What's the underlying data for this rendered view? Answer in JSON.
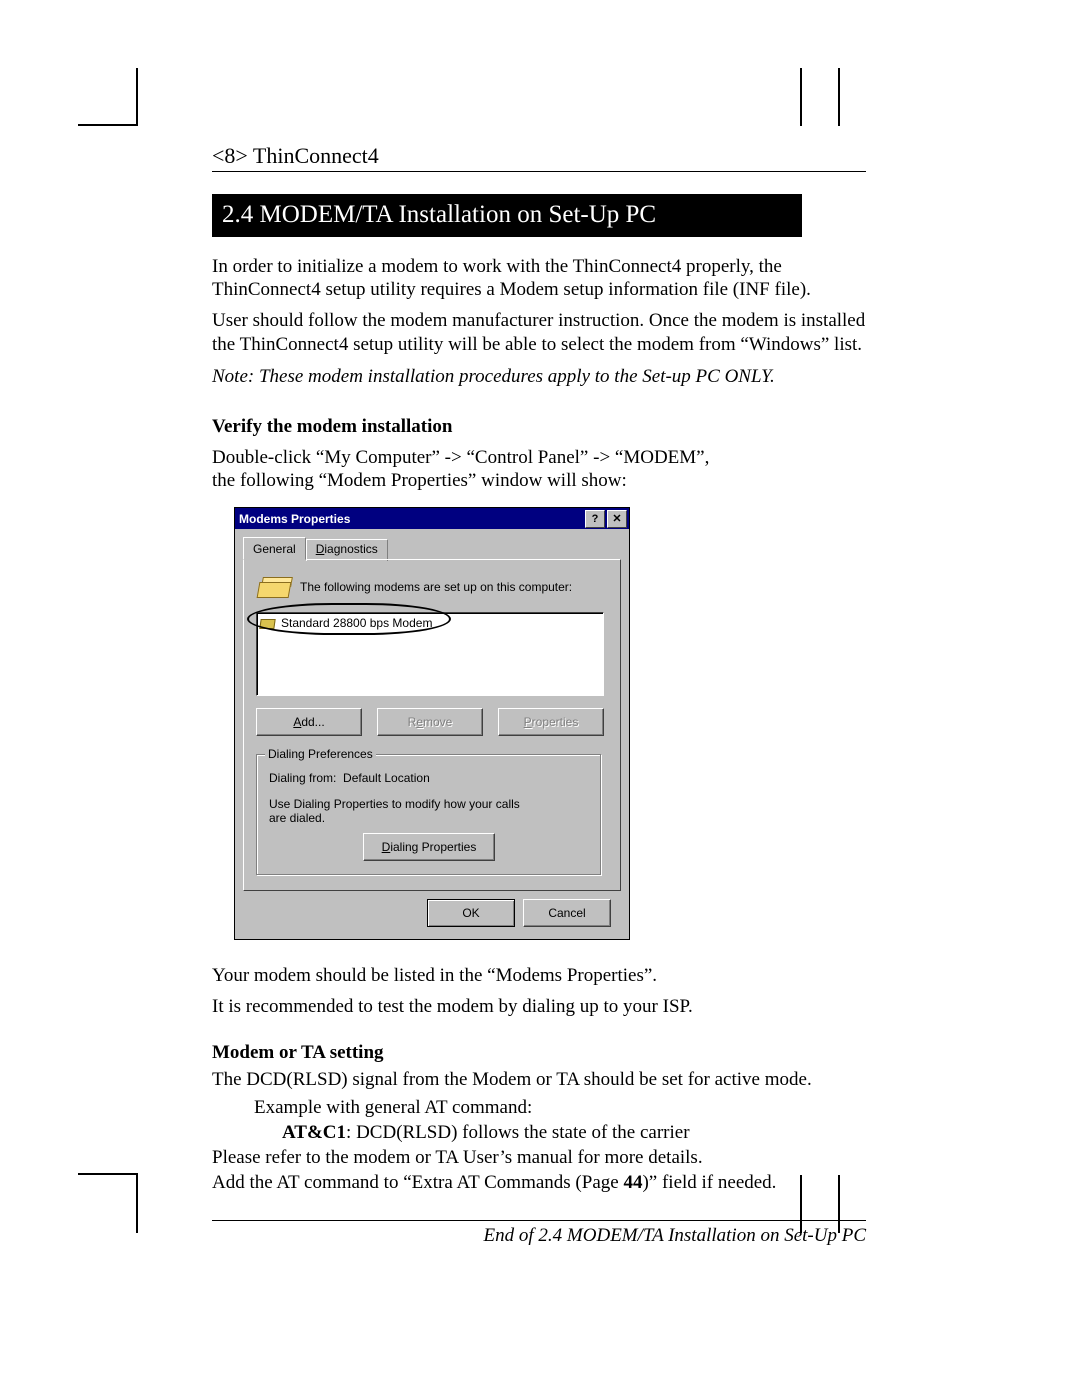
{
  "header": {
    "page_label": "<8> ThinConnect4"
  },
  "section": {
    "title": "2.4 MODEM/TA Installation on Set-Up PC"
  },
  "intro": {
    "p1": "In order to initialize a modem to work with the ThinConnect4 properly, the ThinConnect4 setup utility requires a Modem setup information file (INF file).",
    "p2": "User should follow the modem manufacturer instruction. Once the modem is installed the ThinConnect4 setup utility will be able to select the modem from “Windows” list.",
    "note": "Note: These modem installation procedures apply to the Set-up PC ONLY."
  },
  "verify": {
    "heading": "Verify the modem installation",
    "line1": "Double-click “My Computer” -> “Control Panel” -> “MODEM”,",
    "line2": "the following “Modem Properties” window will show:"
  },
  "dialog": {
    "title": "Modems Properties",
    "help_glyph": "?",
    "close_glyph": "✕",
    "tabs": {
      "general": "General",
      "diagnostics": "Diagnostics"
    },
    "info_text": "The following modems are set up on this computer:",
    "list_item": "Standard 28800 bps Modem",
    "buttons": {
      "add": "Add...",
      "remove": "Remove",
      "properties": "Properties"
    },
    "group": {
      "legend": "Dialing Preferences",
      "line1a": "Dialing from:",
      "line1b": "Default Location",
      "line2": "Use Dialing Properties to modify how your calls are dialed.",
      "dp_button": "Dialing Properties"
    },
    "ok": "OK",
    "cancel": "Cancel"
  },
  "after_dialog": {
    "p1": "Your modem should be listed in the “Modems Properties”.",
    "p2": "It is recommended to test the modem by dialing up to your ISP."
  },
  "modemta": {
    "heading": "Modem or TA setting",
    "p1": "The DCD(RLSD) signal from the Modem or TA should be set for active mode.",
    "example_label": "Example with general AT command:",
    "cmd_bold": "AT&C1",
    "cmd_rest": ": DCD(RLSD) follows the state of the carrier",
    "p2": "Please refer to the modem or TA User’s manual for more details.",
    "p3a": "Add the AT command to “Extra AT Commands (Page ",
    "p3bold": "44",
    "p3b": ")” field if needed."
  },
  "footer": {
    "text": "End of 2.4 MODEM/TA Installation on Set-Up PC"
  }
}
